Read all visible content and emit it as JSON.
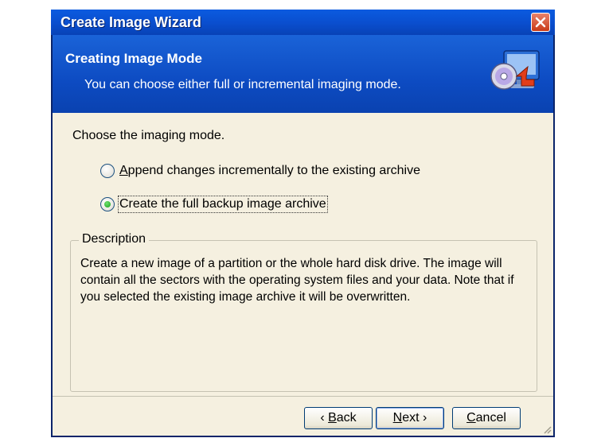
{
  "window": {
    "title": "Create Image Wizard",
    "close_icon": "close-icon"
  },
  "header": {
    "title": "Creating Image Mode",
    "subtitle": "You can choose either full or incremental imaging mode.",
    "icon": "disk-image-icon"
  },
  "content": {
    "prompt": "Choose the imaging mode.",
    "options": [
      {
        "label": "Append changes incrementally to the existing archive",
        "checked": false
      },
      {
        "label": "Create the full backup image archive",
        "checked": true
      }
    ],
    "description": {
      "legend": "Description",
      "text": "Create a new image of a partition or the whole hard disk drive. The image will contain all the sectors with the operating system files and your data. Note that if you selected the existing image archive it will be overwritten."
    }
  },
  "buttons": {
    "back": {
      "arrow": "‹",
      "accel": "B",
      "rest": "ack"
    },
    "next": {
      "accel": "N",
      "rest": "ext",
      "arrow": "›"
    },
    "cancel": {
      "accel": "C",
      "rest": "ancel"
    }
  },
  "colors": {
    "titlebar": "#0a4fd0",
    "header": "#0d4bc2",
    "body": "#f5f0e0",
    "close": "#c93a17"
  }
}
